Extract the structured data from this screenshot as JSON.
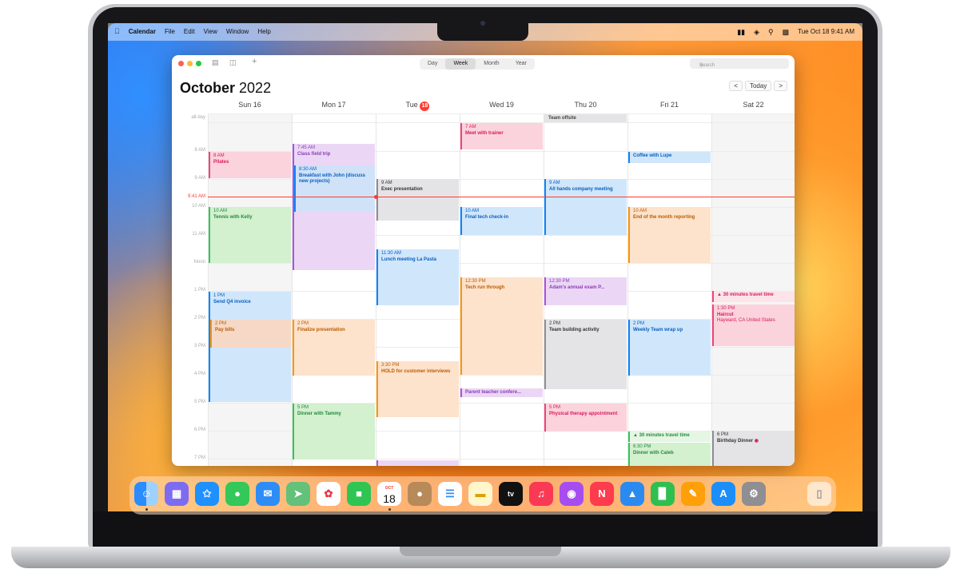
{
  "menubar": {
    "app": "Calendar",
    "items": [
      "File",
      "Edit",
      "View",
      "Window",
      "Help"
    ],
    "clock": "Tue Oct 18 9:41 AM"
  },
  "toolbar": {
    "views": [
      "Day",
      "Week",
      "Month",
      "Year"
    ],
    "selected_view": "Week",
    "search_placeholder": "Search",
    "add_symbol": "+"
  },
  "header": {
    "month": "October",
    "year": "2022",
    "today_label": "Today",
    "prev": "<",
    "next": ">"
  },
  "days": [
    {
      "label": "Sun 16"
    },
    {
      "label": "Mon 17"
    },
    {
      "label": "Tue",
      "today_num": "18"
    },
    {
      "label": "Wed 19"
    },
    {
      "label": "Thu 20"
    },
    {
      "label": "Fri 21"
    },
    {
      "label": "Sat 22"
    }
  ],
  "hours": [
    "all-day",
    "8 AM",
    "9 AM",
    "10 AM",
    "11 AM",
    "Noon",
    "1 PM",
    "2 PM",
    "3 PM",
    "4 PM",
    "5 PM",
    "6 PM",
    "7 PM"
  ],
  "now_label": "9:41 AM",
  "all_day_event": "Team offsite",
  "events": [
    {
      "day": 0,
      "time": "8 AM",
      "title": "Pilates",
      "color": "pink"
    },
    {
      "day": 0,
      "time": "10 AM",
      "title": "Tennis with Kelly",
      "color": "green"
    },
    {
      "day": 0,
      "time": "1 PM",
      "title": "Send Q4 invoice",
      "color": "blue"
    },
    {
      "day": 0,
      "time": "2 PM",
      "title": "Pay bills",
      "color": "orange"
    },
    {
      "day": 1,
      "time": "7:45 AM",
      "title": "Class field trip",
      "color": "purple"
    },
    {
      "day": 1,
      "time": "8:30 AM",
      "title": "Breakfast with John (discuss new projects)",
      "color": "blue"
    },
    {
      "day": 1,
      "time": "2 PM",
      "title": "Finalize presentation",
      "color": "orange"
    },
    {
      "day": 1,
      "time": "5 PM",
      "title": "Dinner with Tammy",
      "color": "green"
    },
    {
      "day": 2,
      "time": "9 AM",
      "title": "Exec presentation",
      "color": "gray"
    },
    {
      "day": 2,
      "time": "11:30 AM",
      "title": "Lunch meeting La Pasta",
      "color": "blue"
    },
    {
      "day": 2,
      "time": "3:30 PM",
      "title": "HOLD for customer interviews",
      "color": "orange"
    },
    {
      "day": 3,
      "time": "7 AM",
      "title": "Meet with trainer",
      "color": "pink"
    },
    {
      "day": 3,
      "time": "10 AM",
      "title": "Final tech check-in",
      "color": "blue"
    },
    {
      "day": 3,
      "time": "12:30 PM",
      "title": "Tech run through",
      "color": "orange"
    },
    {
      "day": 3,
      "time": "",
      "title": "Parent teacher confere...",
      "color": "purple"
    },
    {
      "day": 4,
      "time": "9 AM",
      "title": "All hands company meeting",
      "color": "blue"
    },
    {
      "day": 4,
      "time": "12:30 PM",
      "title": "Adam's annual exam P...",
      "color": "purple"
    },
    {
      "day": 4,
      "time": "2 PM",
      "title": "Team building activity",
      "color": "gray"
    },
    {
      "day": 4,
      "time": "5 PM",
      "title": "Physical therapy appointment",
      "color": "pink"
    },
    {
      "day": 5,
      "time": "",
      "title": "Coffee with Lupe",
      "color": "blue"
    },
    {
      "day": 5,
      "time": "10 AM",
      "title": "End of the month reporting",
      "color": "orange"
    },
    {
      "day": 5,
      "time": "2 PM",
      "title": "Weekly Team wrap up",
      "color": "blue"
    },
    {
      "day": 5,
      "time": "",
      "title": "30 minutes travel time",
      "color": "green"
    },
    {
      "day": 5,
      "time": "6:30 PM",
      "title": "Dinner with Caleb",
      "color": "green"
    },
    {
      "day": 6,
      "time": "",
      "title": "30 minutes travel time",
      "color": "pink"
    },
    {
      "day": 6,
      "time": "1:30 PM",
      "title": "Haircut",
      "sub": "Hayward, CA United States",
      "color": "pink"
    },
    {
      "day": 6,
      "time": "6 PM",
      "title": "Birthday Dinner",
      "color": "gray"
    }
  ],
  "dock": [
    {
      "name": "finder"
    },
    {
      "name": "launchpad"
    },
    {
      "name": "safari"
    },
    {
      "name": "messages"
    },
    {
      "name": "mail"
    },
    {
      "name": "maps"
    },
    {
      "name": "photos"
    },
    {
      "name": "facetime"
    },
    {
      "name": "calendar",
      "label_month": "OCT",
      "label_day": "18"
    },
    {
      "name": "contacts"
    },
    {
      "name": "reminders"
    },
    {
      "name": "notes"
    },
    {
      "name": "tv",
      "label": "tv"
    },
    {
      "name": "music"
    },
    {
      "name": "podcasts"
    },
    {
      "name": "news"
    },
    {
      "name": "keynote"
    },
    {
      "name": "numbers"
    },
    {
      "name": "pages"
    },
    {
      "name": "app-store"
    },
    {
      "name": "system-settings"
    },
    {
      "name": "trash"
    }
  ]
}
